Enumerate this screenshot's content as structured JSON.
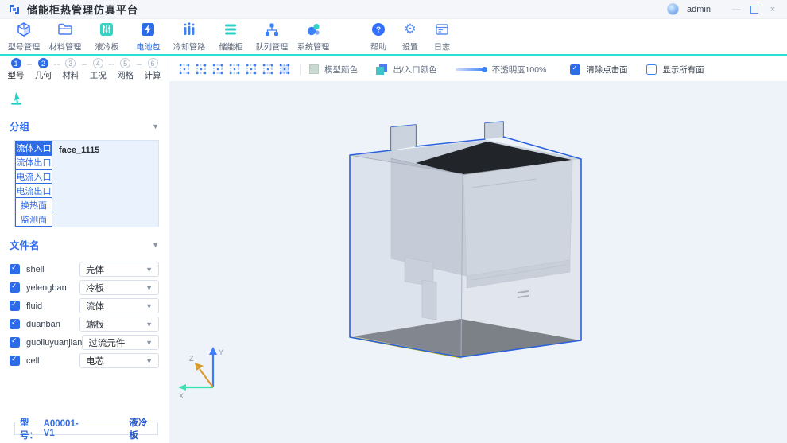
{
  "title_bar": {
    "app_title": "储能柜热管理仿真平台",
    "username": "admin",
    "controls": {
      "minimize": "—",
      "close": "×"
    }
  },
  "main_toolbar": {
    "items": [
      {
        "label": "型号管理",
        "icon": "cube-icon",
        "active": false
      },
      {
        "label": "材料管理",
        "icon": "folder-icon",
        "active": false
      },
      {
        "label": "液冷板",
        "icon": "sliders-icon",
        "active": false
      },
      {
        "label": "电池包",
        "icon": "battery-icon",
        "active": true
      },
      {
        "label": "冷却管路",
        "icon": "pipes-icon",
        "active": false
      },
      {
        "label": "储能柜",
        "icon": "cabinet-icon",
        "active": false
      },
      {
        "label": "队列管理",
        "icon": "queue-icon",
        "active": false
      },
      {
        "label": "系统管理",
        "icon": "system-icon",
        "active": false
      }
    ],
    "secondary": [
      {
        "label": "帮助",
        "icon": "help-icon"
      },
      {
        "label": "设置",
        "icon": "gear-icon"
      },
      {
        "label": "日志",
        "icon": "log-icon"
      }
    ]
  },
  "steps": [
    {
      "num": "1",
      "label": "型号",
      "state": "done"
    },
    {
      "num": "2",
      "label": "几何",
      "state": "active"
    },
    {
      "num": "3",
      "label": "材料",
      "state": "todo"
    },
    {
      "num": "4",
      "label": "工况",
      "state": "todo"
    },
    {
      "num": "5",
      "label": "网格",
      "state": "todo"
    },
    {
      "num": "6",
      "label": "计算",
      "state": "todo"
    }
  ],
  "groups": {
    "header": "分组",
    "tabs": [
      {
        "label": "流体入口",
        "selected": true
      },
      {
        "label": "流体出口",
        "selected": false
      },
      {
        "label": "电流入口",
        "selected": false
      },
      {
        "label": "电流出口",
        "selected": false
      },
      {
        "label": "换热面",
        "selected": false
      },
      {
        "label": "监测面",
        "selected": false
      }
    ],
    "faces": [
      "face_1115"
    ]
  },
  "files": {
    "header": "文件名",
    "rows": [
      {
        "name": "shell",
        "value": "壳体",
        "checked": true
      },
      {
        "name": "yelengban",
        "value": "冷板",
        "checked": true
      },
      {
        "name": "fluid",
        "value": "流体",
        "checked": true
      },
      {
        "name": "duanban",
        "value": "端板",
        "checked": true
      },
      {
        "name": "guoliuyuanjian",
        "value": "过流元件",
        "checked": true
      },
      {
        "name": "cell",
        "value": "电芯",
        "checked": true
      }
    ]
  },
  "status_bar": {
    "model_label": "型号：",
    "model_value": "A00001-V1",
    "module": "液冷板"
  },
  "viewport_toolbar": {
    "view_cube_buttons": 7,
    "legend_model": "模型颜色",
    "legend_ports": "出/入口颜色",
    "opacity_label": "不透明度100%",
    "checkbox_clear": {
      "label": "清除点击面",
      "checked": true
    },
    "checkbox_showall": {
      "label": "显示所有面",
      "checked": false
    }
  },
  "axis": {
    "x": "X",
    "y": "Y",
    "z": "Z"
  },
  "colors": {
    "accent_blue": "#2E6BE6",
    "accent_teal": "#2ADFD4",
    "viewport_bg": "#EEF3FA",
    "model_gray": "#CDD4DF",
    "model_dark": "#24272D",
    "edge_blue": "#2A62DA",
    "bottom_edge_yellow": "#C0B000",
    "axis_x": "#35E3AE",
    "axis_y": "#3B7CFF",
    "axis_z": "#D99A2E"
  }
}
